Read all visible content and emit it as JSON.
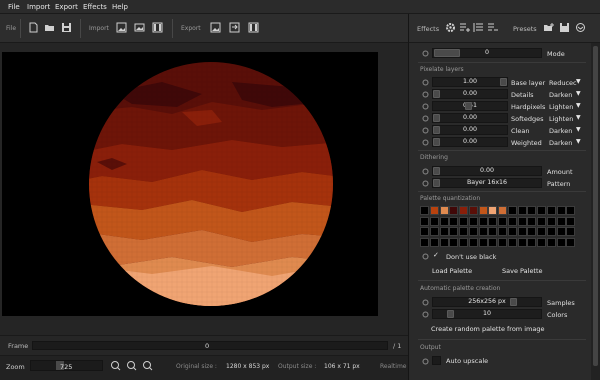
{
  "menu": [
    "File",
    "Import",
    "Export",
    "Effects",
    "Help"
  ],
  "toolbar": {
    "file_label": "File",
    "import_label": "Import",
    "export_label": "Export"
  },
  "effects_header": {
    "effects_label": "Effects",
    "presets_label": "Presets"
  },
  "mode_row": {
    "value": "0",
    "label": "Mode"
  },
  "pixelate": {
    "title": "Pixelate layers",
    "rows": [
      {
        "value": "1.00",
        "label": "Base layer",
        "blend": "Reducec"
      },
      {
        "value": "0.00",
        "label": "Details",
        "blend": "Darken"
      },
      {
        "value": "0.51",
        "label": "Hardpixels",
        "blend": "Lighten"
      },
      {
        "value": "0.00",
        "label": "Softedges",
        "blend": "Lighten"
      },
      {
        "value": "0.00",
        "label": "Clean",
        "blend": "Darken"
      },
      {
        "value": "0.00",
        "label": "Weighted",
        "blend": "Darken"
      }
    ]
  },
  "dithering": {
    "title": "Dithering",
    "amount_value": "0.00",
    "amount_label": "Amount",
    "pattern_value": "Bayer 16x16",
    "pattern_label": "Pattern"
  },
  "palette": {
    "title": "Palette quantization",
    "colors": [
      "#000000",
      "#b8420e",
      "#e08a4f",
      "#400808",
      "#8a1f0a",
      "#5a0f08",
      "#c2561a",
      "#f0a473",
      "#d06e35"
    ],
    "dont_use_black_label": "Don't use black",
    "load_label": "Load Palette",
    "save_label": "Save Palette"
  },
  "auto_palette": {
    "title": "Automatic palette creation",
    "samples_value": "256x256 px",
    "samples_label": "Samples",
    "colors_value": "10",
    "colors_label": "Colors",
    "random_label": "Create random palette from image"
  },
  "output": {
    "title": "Output",
    "auto_upscale_label": "Auto upscale"
  },
  "frame": {
    "label": "Frame",
    "value": "0",
    "total": "/ 1"
  },
  "status": {
    "zoom_label": "Zoom",
    "zoom_value": "725",
    "original_label": "Original size :",
    "original_value": "1280 x 853 px",
    "output_label": "Output size :",
    "output_value": "106 x 71 px",
    "realtime_label": "Realtime"
  },
  "colors": {
    "accent": "#e8803a",
    "moon_dark": "#5a0f08",
    "moon_light": "#f0a473"
  }
}
